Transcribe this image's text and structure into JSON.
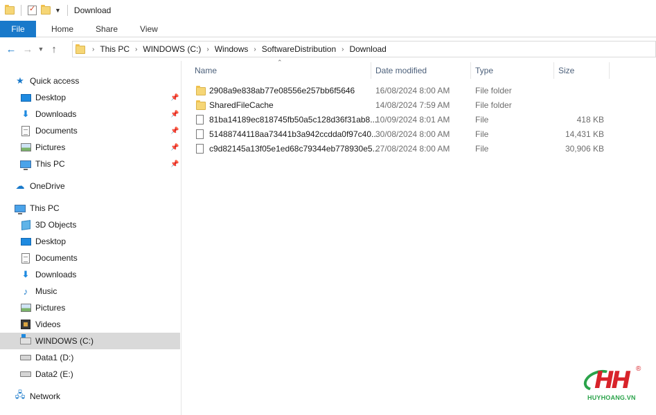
{
  "window": {
    "title": "Download"
  },
  "ribbon": {
    "tabs": [
      "File",
      "Home",
      "Share",
      "View"
    ]
  },
  "address": {
    "crumbs": [
      "This PC",
      "WINDOWS (C:)",
      "Windows",
      "SoftwareDistribution",
      "Download"
    ]
  },
  "sidebar": {
    "items": [
      {
        "label": "Quick access",
        "icon": "star-icon"
      },
      {
        "label": "Desktop",
        "icon": "desktop-icon"
      },
      {
        "label": "Downloads",
        "icon": "downloads-icon"
      },
      {
        "label": "Documents",
        "icon": "documents-icon"
      },
      {
        "label": "Pictures",
        "icon": "pictures-icon"
      },
      {
        "label": "This PC",
        "icon": "computer-icon"
      },
      {
        "label": "OneDrive",
        "icon": "cloud-icon"
      },
      {
        "label": "This PC",
        "icon": "computer-icon"
      },
      {
        "label": "3D Objects",
        "icon": "3d-objects-icon"
      },
      {
        "label": "Desktop",
        "icon": "desktop-icon"
      },
      {
        "label": "Documents",
        "icon": "documents-icon"
      },
      {
        "label": "Downloads",
        "icon": "downloads-icon"
      },
      {
        "label": "Music",
        "icon": "music-icon"
      },
      {
        "label": "Pictures",
        "icon": "pictures-icon"
      },
      {
        "label": "Videos",
        "icon": "videos-icon"
      },
      {
        "label": "WINDOWS (C:)",
        "icon": "windows-drive-icon"
      },
      {
        "label": "Data1 (D:)",
        "icon": "drive-icon"
      },
      {
        "label": "Data2 (E:)",
        "icon": "drive-icon"
      },
      {
        "label": "Network",
        "icon": "network-icon"
      }
    ]
  },
  "columns": {
    "name": "Name",
    "date": "Date modified",
    "type": "Type",
    "size": "Size"
  },
  "files": [
    {
      "name": "2908a9e838ab77e08556e257bb6f5646",
      "date": "16/08/2024 8:00 AM",
      "type": "File folder",
      "size": "",
      "icon": "folder-icon"
    },
    {
      "name": "SharedFileCache",
      "date": "14/08/2024 7:59 AM",
      "type": "File folder",
      "size": "",
      "icon": "folder-icon"
    },
    {
      "name": "81ba14189ec818745fb50a5c128d36f31ab8...",
      "date": "10/09/2024 8:01 AM",
      "type": "File",
      "size": "418 KB",
      "icon": "file-icon"
    },
    {
      "name": "51488744118aa73441b3a942ccdda0f97c40...",
      "date": "30/08/2024 8:00 AM",
      "type": "File",
      "size": "14,431 KB",
      "icon": "file-icon"
    },
    {
      "name": "c9d82145a13f05e1ed68c79344eb778930e5...",
      "date": "27/08/2024 8:00 AM",
      "type": "File",
      "size": "30,906 KB",
      "icon": "file-icon"
    }
  ],
  "logo": {
    "brand": "HUYHOANG.VN",
    "mark": "HH",
    "reg": "®"
  }
}
